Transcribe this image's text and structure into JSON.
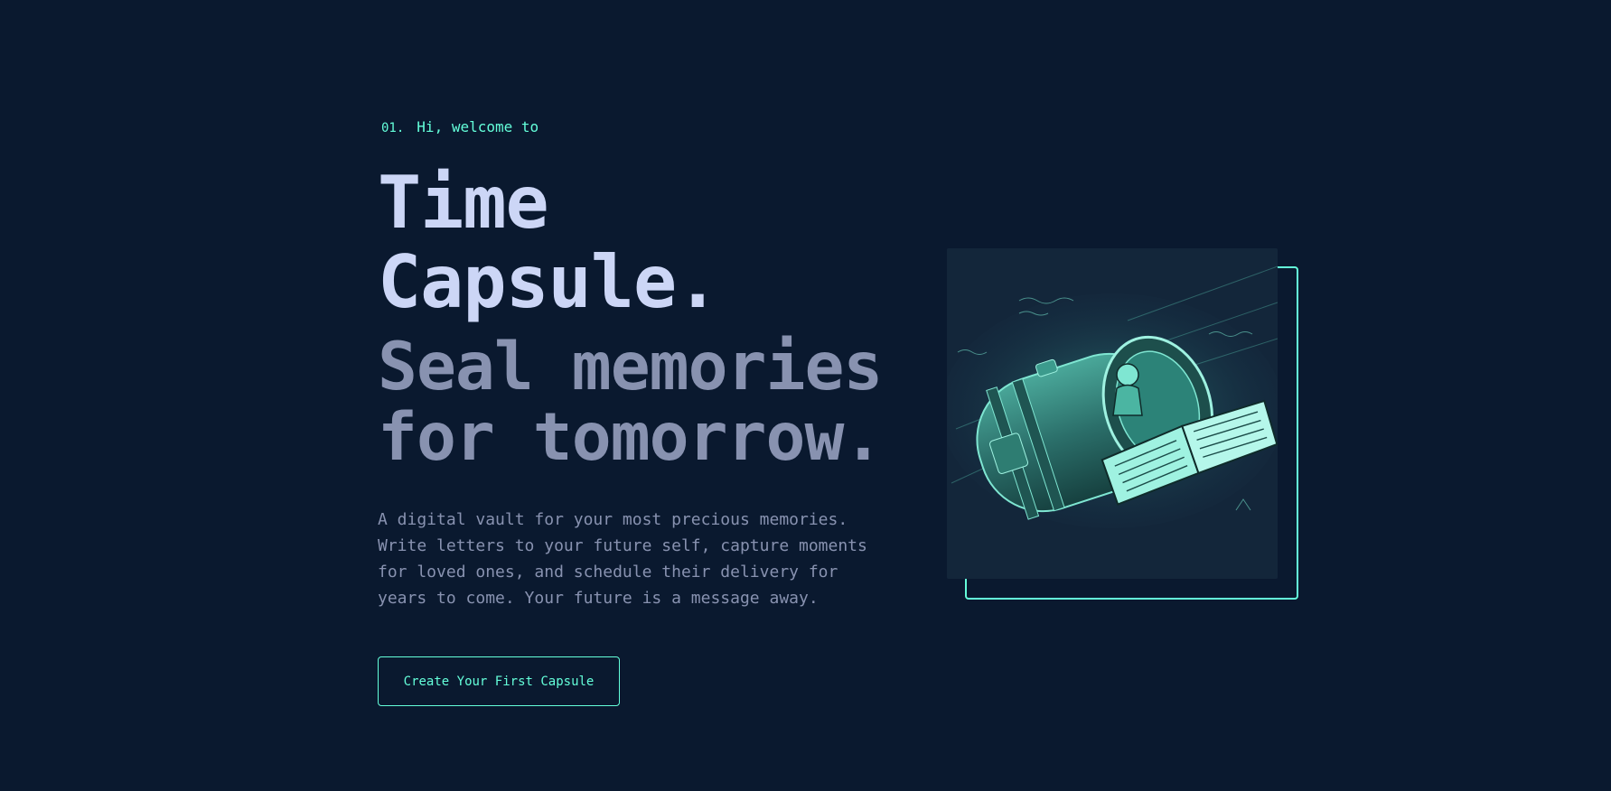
{
  "hero": {
    "number": "01.",
    "greeting": "Hi, welcome to",
    "title_line1": "Time",
    "title_line2": "Capsule.",
    "subtitle_line1": "Seal memories",
    "subtitle_line2": "for tomorrow.",
    "description_lines": [
      "A digital vault for your most precious memories.",
      "Write letters to your future self, capture moments",
      "for loved ones, and schedule their delivery for",
      "years to come. Your future is a message away."
    ],
    "cta_label": "Create Your First Capsule"
  },
  "colors": {
    "background": "#0a192f",
    "accent": "#64ffda",
    "title": "#ccd6f6",
    "muted": "#8892b0"
  },
  "icons": {
    "illustration": "time-capsule-illustration"
  }
}
